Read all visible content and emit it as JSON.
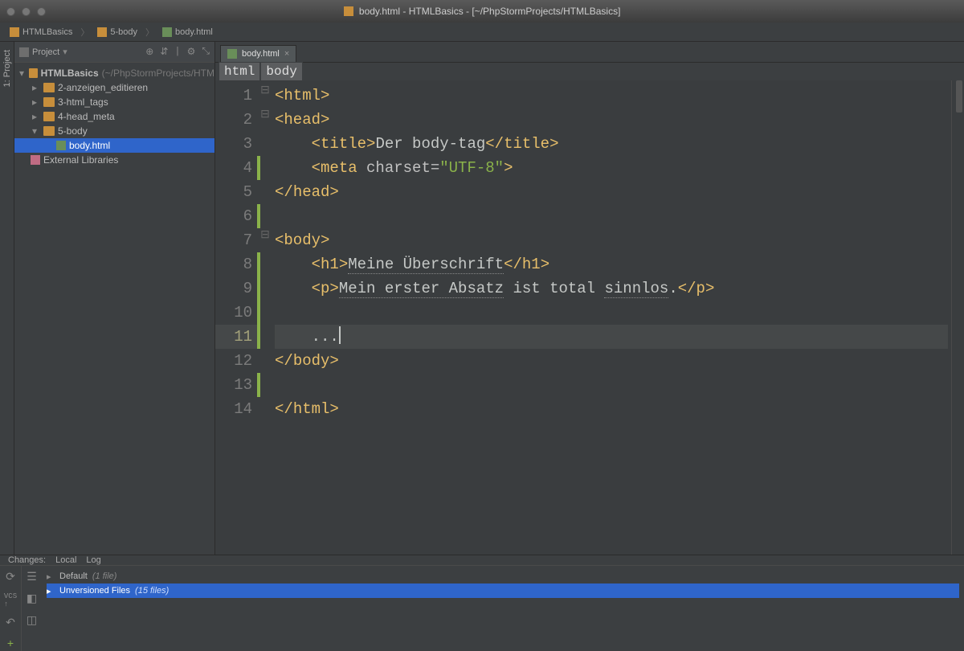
{
  "titlebar": {
    "title": "body.html - HTMLBasics - [~/PhpStormProjects/HTMLBasics]"
  },
  "breadcrumbs": {
    "items": [
      "HTMLBasics",
      "5-body",
      "body.html"
    ]
  },
  "left_tool_label": "1: Project",
  "sidebar": {
    "header": "Project",
    "root": {
      "name": "HTMLBasics",
      "hint": "(~/PhpStormProjects/HTM"
    },
    "folders": [
      "2-anzeigen_editieren",
      "3-html_tags",
      "4-head_meta",
      "5-body"
    ],
    "file": "body.html",
    "external": "External Libraries"
  },
  "tabs": {
    "items": [
      {
        "label": "body.html"
      }
    ]
  },
  "path_segments": [
    "html",
    "body"
  ],
  "code": {
    "lines": [
      {
        "n": 1,
        "fold": "⊟",
        "chg": false,
        "cur": false,
        "tokens": [
          [
            "b",
            "<"
          ],
          [
            "n",
            "html"
          ],
          [
            "b",
            ">"
          ]
        ]
      },
      {
        "n": 2,
        "fold": "⊟",
        "chg": false,
        "cur": false,
        "tokens": [
          [
            "b",
            "<"
          ],
          [
            "n",
            "head"
          ],
          [
            "b",
            ">"
          ]
        ]
      },
      {
        "n": 3,
        "fold": "",
        "chg": false,
        "cur": false,
        "tokens": [
          [
            "t",
            "    "
          ],
          [
            "b",
            "<"
          ],
          [
            "n",
            "title"
          ],
          [
            "b",
            ">"
          ],
          [
            "t",
            "Der body-tag"
          ],
          [
            "b",
            "</"
          ],
          [
            "n",
            "title"
          ],
          [
            "b",
            ">"
          ]
        ]
      },
      {
        "n": 4,
        "fold": "",
        "chg": true,
        "cur": false,
        "tokens": [
          [
            "t",
            "    "
          ],
          [
            "b",
            "<"
          ],
          [
            "n",
            "meta "
          ],
          [
            "an",
            "charset="
          ],
          [
            "av",
            "\"UTF-8\""
          ],
          [
            "b",
            ">"
          ]
        ]
      },
      {
        "n": 5,
        "fold": "",
        "chg": false,
        "cur": false,
        "tokens": [
          [
            "b",
            "</"
          ],
          [
            "n",
            "head"
          ],
          [
            "b",
            ">"
          ]
        ]
      },
      {
        "n": 6,
        "fold": "",
        "chg": true,
        "cur": false,
        "tokens": [
          [
            "t",
            ""
          ]
        ]
      },
      {
        "n": 7,
        "fold": "⊟",
        "chg": false,
        "cur": false,
        "tokens": [
          [
            "b",
            "<"
          ],
          [
            "n",
            "body"
          ],
          [
            "b",
            ">"
          ]
        ]
      },
      {
        "n": 8,
        "fold": "",
        "chg": true,
        "cur": false,
        "tokens": [
          [
            "t",
            "    "
          ],
          [
            "b",
            "<"
          ],
          [
            "n",
            "h1"
          ],
          [
            "b",
            ">"
          ],
          [
            "tu",
            "Meine Überschrift"
          ],
          [
            "b",
            "</"
          ],
          [
            "n",
            "h1"
          ],
          [
            "b",
            ">"
          ]
        ]
      },
      {
        "n": 9,
        "fold": "",
        "chg": true,
        "cur": false,
        "tokens": [
          [
            "t",
            "    "
          ],
          [
            "b",
            "<"
          ],
          [
            "n",
            "p"
          ],
          [
            "b",
            ">"
          ],
          [
            "tu",
            "Mein erster Absatz"
          ],
          [
            "t",
            " ist total "
          ],
          [
            "tu",
            "sinnlos"
          ],
          [
            "t",
            "."
          ],
          [
            "b",
            "</"
          ],
          [
            "n",
            "p"
          ],
          [
            "b",
            ">"
          ]
        ]
      },
      {
        "n": 10,
        "fold": "",
        "chg": true,
        "cur": false,
        "tokens": [
          [
            "t",
            ""
          ]
        ]
      },
      {
        "n": 11,
        "fold": "",
        "chg": true,
        "cur": true,
        "tokens": [
          [
            "t",
            "    ..."
          ],
          [
            "cur",
            ""
          ]
        ]
      },
      {
        "n": 12,
        "fold": "",
        "chg": false,
        "cur": false,
        "tokens": [
          [
            "b",
            "</"
          ],
          [
            "n",
            "body"
          ],
          [
            "b",
            ">"
          ]
        ]
      },
      {
        "n": 13,
        "fold": "",
        "chg": true,
        "cur": false,
        "tokens": [
          [
            "t",
            ""
          ]
        ]
      },
      {
        "n": 14,
        "fold": "",
        "chg": false,
        "cur": false,
        "tokens": [
          [
            "b",
            "</"
          ],
          [
            "n",
            "html"
          ],
          [
            "b",
            ">"
          ]
        ]
      }
    ]
  },
  "bottom": {
    "tabs": [
      "Changes:",
      "Local",
      "Log"
    ],
    "rows": [
      {
        "sel": false,
        "label": "Default",
        "hint": "(1 file)"
      },
      {
        "sel": true,
        "label": "Unversioned Files",
        "hint": "(15 files)"
      }
    ]
  }
}
